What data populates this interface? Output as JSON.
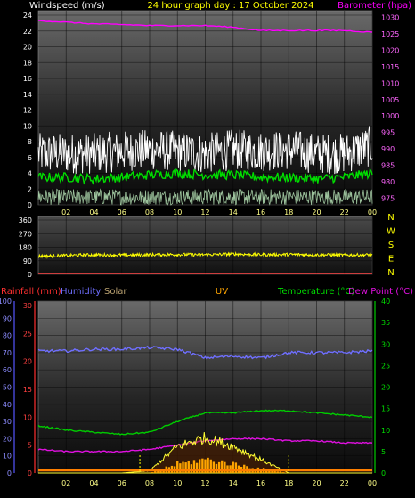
{
  "header": {
    "left_label": "Windspeed (m/s)",
    "title": "24 hour graph day : 17 October 2024",
    "right_label": "Barometer (hpa)"
  },
  "colors": {
    "wind": "#ffffff",
    "wind_avg": "#00dd00",
    "wind_lo": "#ccffcc",
    "barometer": "#ff00ff",
    "direction": "#ffff00",
    "humidity": "#6f6fff",
    "rain": "#ff3030",
    "solar": "#ffaa00",
    "uv": "#ffa500",
    "temp": "#00cc00",
    "dew": "#e010e0"
  },
  "top": {
    "left_ticks": [
      "0",
      "2",
      "4",
      "6",
      "8",
      "10",
      "12",
      "14",
      "16",
      "18",
      "20",
      "22",
      "24"
    ],
    "right_ticks": [
      "975",
      "980",
      "985",
      "990",
      "995",
      "1000",
      "1005",
      "1010",
      "1015",
      "1020",
      "1025",
      "1030"
    ]
  },
  "mid": {
    "ticks": [
      "0",
      "90",
      "180",
      "270",
      "360"
    ],
    "compass": [
      "N",
      "W",
      "S",
      "E",
      "N"
    ]
  },
  "bottom": {
    "legend": {
      "rainfall": "Rainfall (mm)",
      "humidity": "Humidity",
      "solar": "Solar",
      "uv": "UV",
      "temp": "Temperature (°C)",
      "dew": "Dew Point (°C)"
    },
    "humidity_ticks": [
      "0",
      "10",
      "20",
      "30",
      "40",
      "50",
      "60",
      "70",
      "80",
      "90",
      "100"
    ],
    "rain_ticks": [
      "0",
      "5",
      "10",
      "15",
      "20",
      "25",
      "30"
    ],
    "temp_ticks": [
      "0",
      "5",
      "10",
      "15",
      "20",
      "25",
      "30",
      "35",
      "40"
    ]
  },
  "x_ticks": [
    "02",
    "04",
    "06",
    "08",
    "10",
    "12",
    "14",
    "16",
    "18",
    "20",
    "22",
    "00"
  ],
  "chart_data": [
    {
      "type": "line",
      "title": "24 hour graph day : 17 October 2024",
      "x": [
        "00",
        "02",
        "04",
        "06",
        "08",
        "10",
        "12",
        "14",
        "16",
        "18",
        "20",
        "22",
        "00"
      ],
      "ylabel": "Windspeed (m/s)",
      "ylim": [
        0,
        24
      ],
      "y2label": "Barometer (hpa)",
      "y2lim": [
        973,
        1032
      ],
      "series": [
        {
          "axis": "y",
          "values": [
            6.5,
            6.5,
            6.5,
            6.8,
            7,
            6.8,
            6.5,
            7,
            6.8,
            7,
            6.5,
            6.5,
            7.5
          ]
        },
        {
          "axis": "y",
          "values": [
            3.5,
            3.5,
            3.3,
            3.5,
            3.8,
            4,
            3.8,
            3.8,
            3.5,
            3.5,
            3.3,
            3.5,
            4
          ]
        },
        {
          "axis": "y",
          "values": [
            1,
            1,
            1,
            1,
            1,
            1,
            1,
            1,
            1,
            1,
            1,
            1,
            1
          ]
        },
        {
          "axis": "y2",
          "values": [
            1029,
            1028.5,
            1028,
            1027.8,
            1027.5,
            1027.5,
            1027.5,
            1027,
            1026,
            1026,
            1026,
            1026,
            1025.5
          ]
        }
      ]
    },
    {
      "type": "line",
      "x": [
        "00",
        "02",
        "04",
        "06",
        "08",
        "10",
        "12",
        "14",
        "16",
        "18",
        "20",
        "22",
        "00"
      ],
      "ylim": [
        0,
        360
      ],
      "series": [
        {
          "values": [
            120,
            125,
            130,
            128,
            130,
            132,
            130,
            135,
            130,
            132,
            130,
            128,
            130
          ]
        }
      ]
    },
    {
      "type": "line",
      "x": [
        "00",
        "02",
        "04",
        "06",
        "08",
        "10",
        "12",
        "14",
        "16",
        "18",
        "20",
        "22",
        "00"
      ],
      "series": [
        {
          "name": "Humidity",
          "axis": "humidity",
          "ylim": [
            0,
            100
          ],
          "values": [
            71,
            71,
            72,
            72,
            73,
            72,
            67,
            68,
            67,
            70,
            70,
            70,
            71
          ]
        },
        {
          "name": "Temperature (°C)",
          "axis": "temp",
          "ylim": [
            0,
            40
          ],
          "values": [
            11,
            10,
            9.5,
            9,
            9.5,
            12,
            14,
            14,
            14.5,
            14.5,
            14,
            13.5,
            13
          ]
        },
        {
          "name": "Dew Point (°C)",
          "axis": "temp",
          "ylim": [
            0,
            40
          ],
          "values": [
            5.5,
            5,
            5,
            5,
            5.5,
            6.5,
            7.5,
            8,
            8,
            7.5,
            7.5,
            7,
            7
          ]
        },
        {
          "name": "Rainfall (mm)",
          "axis": "rain",
          "ylim": [
            0,
            30
          ],
          "values": [
            0,
            0,
            0,
            0,
            0,
            0,
            0,
            0,
            0,
            0,
            0,
            0,
            0
          ]
        },
        {
          "name": "Solar",
          "axis": "temp",
          "ylim": [
            0,
            40
          ],
          "values": [
            0,
            0,
            0,
            0,
            0.5,
            6,
            8,
            6,
            3,
            0,
            0,
            0,
            0
          ]
        },
        {
          "name": "UV",
          "axis": "temp",
          "ylim": [
            0,
            40
          ],
          "values": [
            0,
            0,
            0,
            0,
            0,
            2,
            3,
            2,
            1,
            0,
            0,
            0,
            0
          ]
        }
      ]
    }
  ]
}
